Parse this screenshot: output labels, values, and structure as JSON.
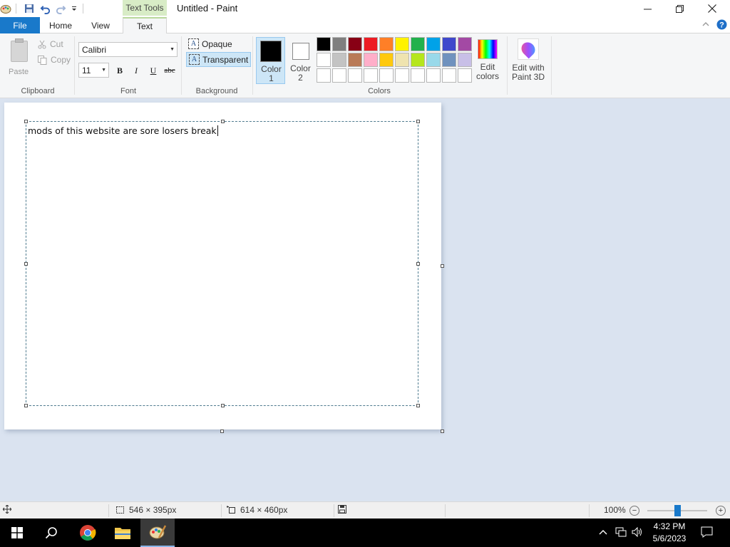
{
  "window": {
    "title": "Untitled - Paint",
    "context_tab_group": "Text Tools"
  },
  "tabs": [
    {
      "label": "File"
    },
    {
      "label": "Home"
    },
    {
      "label": "View"
    },
    {
      "label": "Text"
    }
  ],
  "clipboard": {
    "paste": "Paste",
    "cut": "Cut",
    "copy": "Copy",
    "group_label": "Clipboard"
  },
  "font": {
    "family": "Calibri",
    "size": "11",
    "bold": "B",
    "italic": "I",
    "underline": "U",
    "strike": "abc",
    "group_label": "Font"
  },
  "background": {
    "opaque": "Opaque",
    "transparent": "Transparent",
    "selected": "transparent",
    "group_label": "Background"
  },
  "colors": {
    "color1_label": "Color 1",
    "color2_label": "Color 2",
    "color1_value": "#000000",
    "color2_value": "#ffffff",
    "edit_colors": "Edit colors",
    "group_label": "Colors",
    "palette": [
      [
        "#000000",
        "#7f7f7f",
        "#880015",
        "#ed1c24",
        "#ff7f27",
        "#fff200",
        "#22b14c",
        "#00a2e8",
        "#3f48cc",
        "#a349a4"
      ],
      [
        "#ffffff",
        "#c3c3c3",
        "#b97a57",
        "#ffaec9",
        "#ffc90e",
        "#efe4b0",
        "#b5e61d",
        "#99d9ea",
        "#7092be",
        "#c8bfe7"
      ],
      [
        "#ffffff",
        "#ffffff",
        "#ffffff",
        "#ffffff",
        "#ffffff",
        "#ffffff",
        "#ffffff",
        "#ffffff",
        "#ffffff",
        "#ffffff"
      ]
    ]
  },
  "paint3d": {
    "label": "Edit with Paint 3D"
  },
  "canvas": {
    "text": "mods of this website are sore losers break"
  },
  "status": {
    "selection_size": "546 × 395px",
    "image_size": "614 × 460px",
    "zoom": "100%",
    "zoom_fraction": 0.5
  },
  "taskbar": {
    "time": "4:32 PM",
    "date": "5/6/2023"
  }
}
